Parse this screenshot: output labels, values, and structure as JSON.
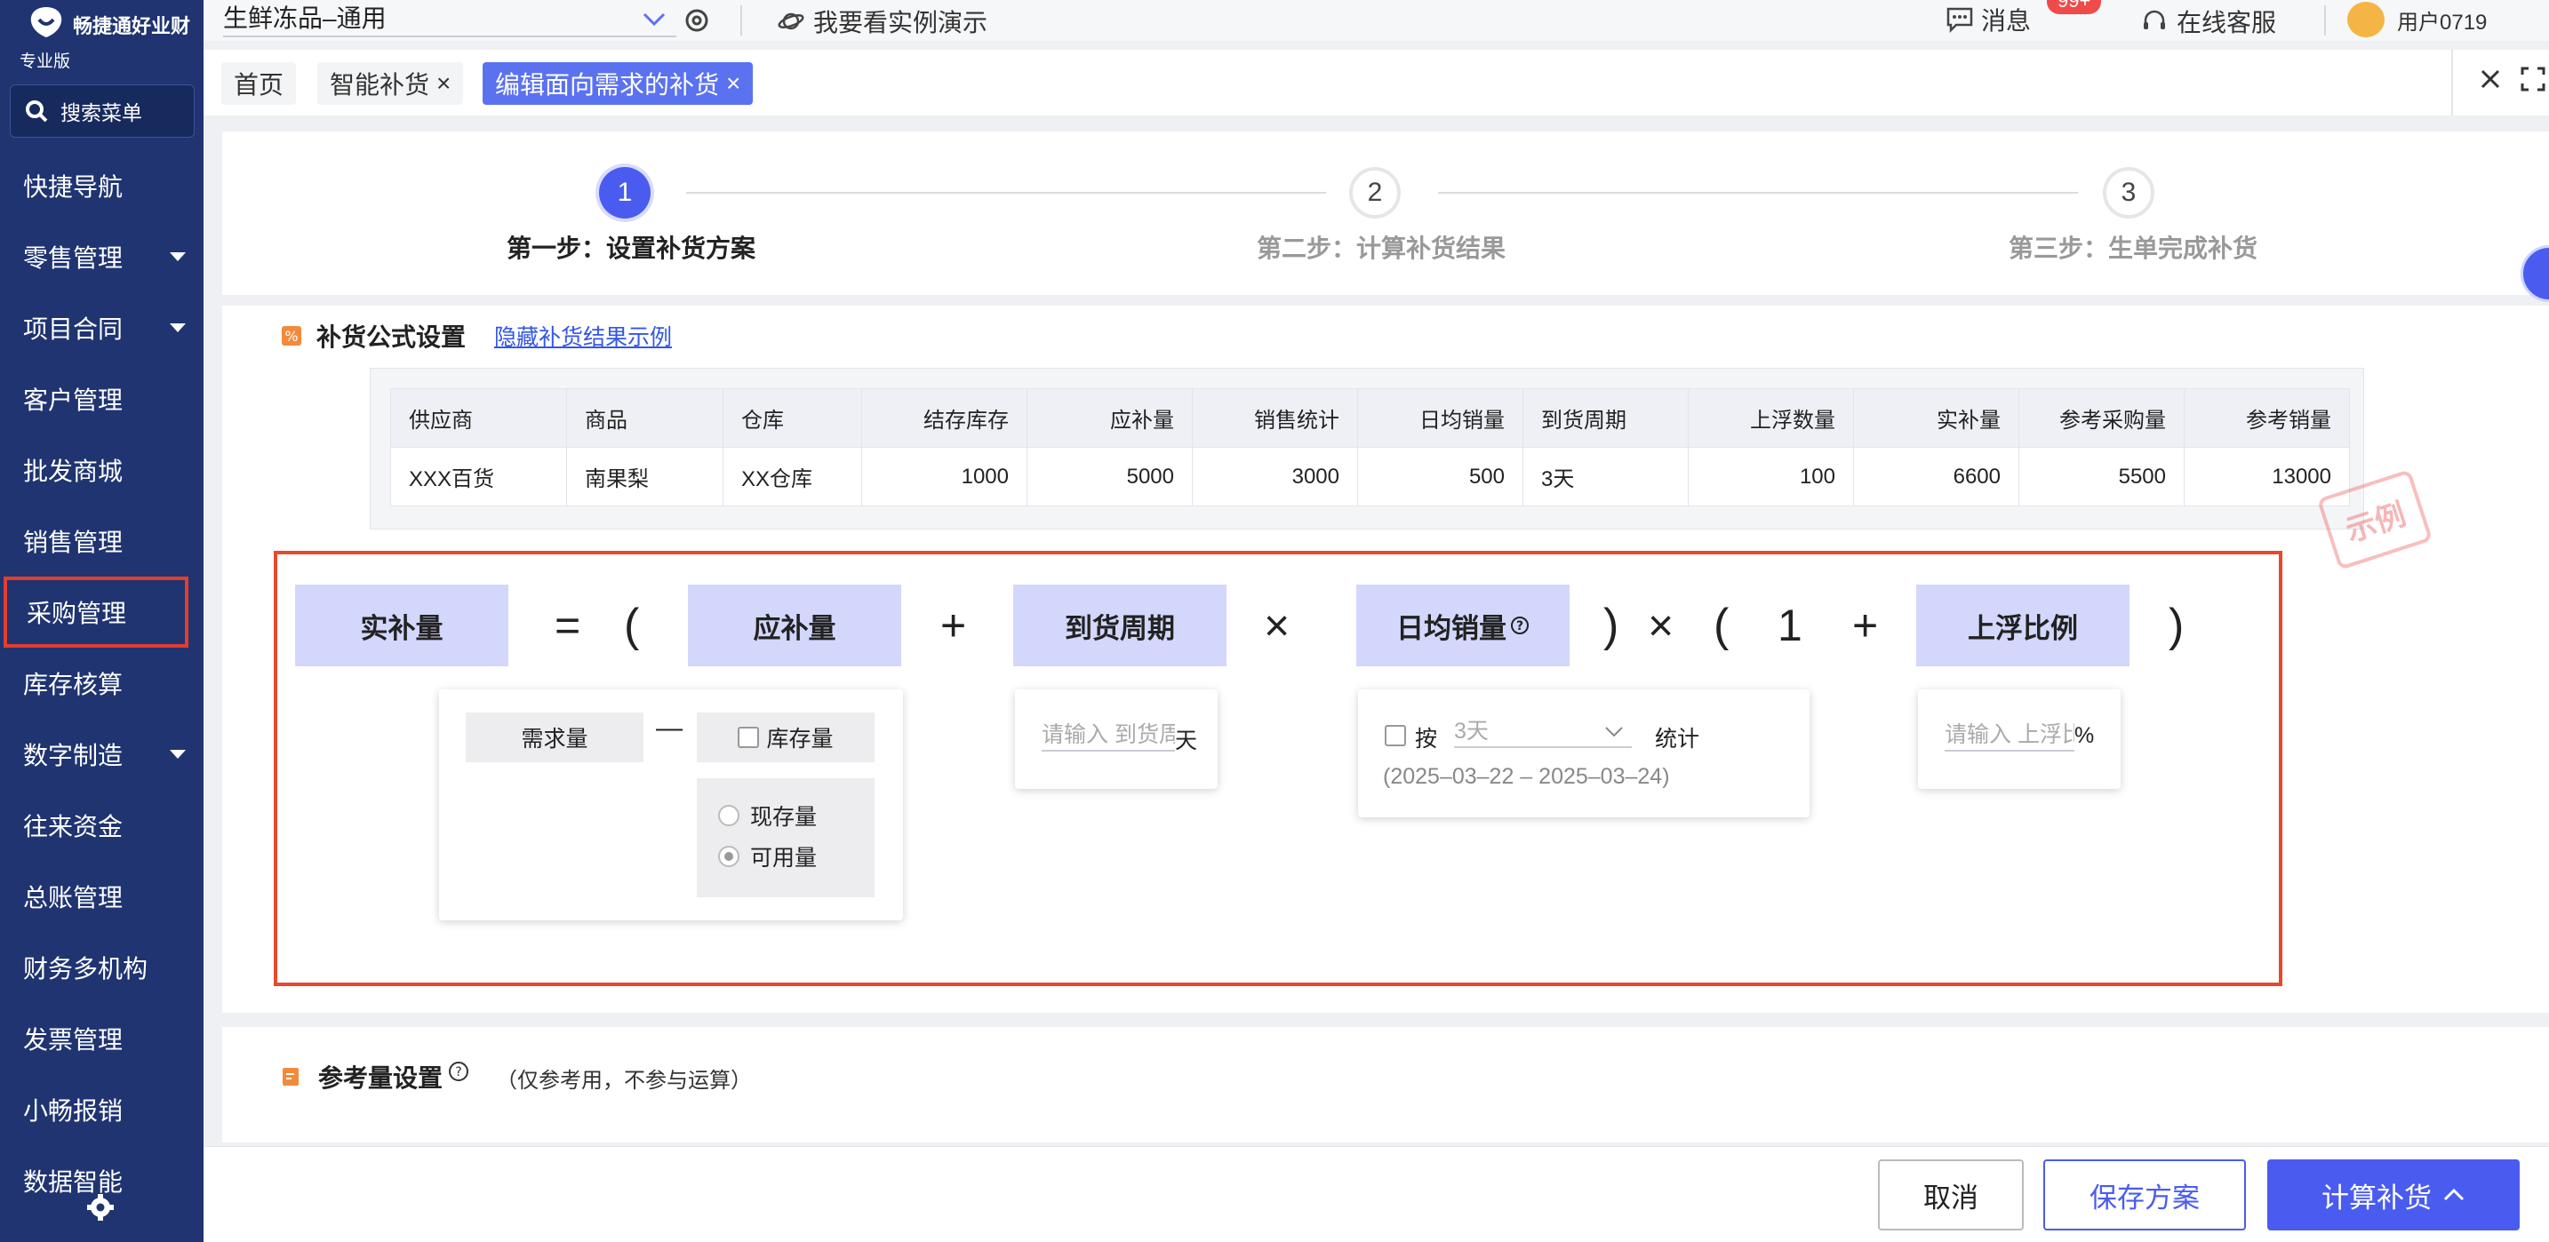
{
  "app": {
    "brand": "畅捷通好业财",
    "edition": "专业版",
    "search_menu": "搜索菜单"
  },
  "sidebar": {
    "items": [
      {
        "label": "快捷导航",
        "has_caret": false
      },
      {
        "label": "零售管理",
        "has_caret": true
      },
      {
        "label": "项目合同",
        "has_caret": true
      },
      {
        "label": "客户管理",
        "has_caret": false
      },
      {
        "label": "批发商城",
        "has_caret": false
      },
      {
        "label": "销售管理",
        "has_caret": false
      },
      {
        "label": "采购管理",
        "has_caret": false
      },
      {
        "label": "库存核算",
        "has_caret": false
      },
      {
        "label": "数字制造",
        "has_caret": true
      },
      {
        "label": "往来资金",
        "has_caret": false
      },
      {
        "label": "总账管理",
        "has_caret": false
      },
      {
        "label": "财务多机构",
        "has_caret": false
      },
      {
        "label": "发票管理",
        "has_caret": false
      },
      {
        "label": "小畅报销",
        "has_caret": false
      },
      {
        "label": "数据智能",
        "has_caret": false
      }
    ],
    "active_index": 6
  },
  "topbar": {
    "store": "生鲜冻品–通用",
    "demo": "我要看实例演示",
    "messages": "消息",
    "message_badge": "99+",
    "service": "在线客服",
    "user": "用户0719"
  },
  "tabs": [
    {
      "label": "首页",
      "closable": false,
      "active": false
    },
    {
      "label": "智能补货",
      "closable": true,
      "active": false
    },
    {
      "label": "编辑面向需求的补货",
      "closable": true,
      "active": true
    }
  ],
  "steps": [
    {
      "number": "1",
      "label": "第一步：设置补货方案",
      "active": true
    },
    {
      "number": "2",
      "label": "第二步：计算补货结果",
      "active": false
    },
    {
      "number": "3",
      "label": "第三步：生单完成补货",
      "active": false
    }
  ],
  "formula_section": {
    "title": "补货公式设置",
    "toggle_link": "隐藏补货结果示例",
    "stamp": "示例",
    "example_table": {
      "headers": [
        "供应商",
        "商品",
        "仓库",
        "结存库存",
        "应补量",
        "销售统计",
        "日均销量",
        "到货周期",
        "上浮数量",
        "实补量",
        "参考采购量",
        "参考销量"
      ],
      "row": [
        "XXX百货",
        "南果梨",
        "XX仓库",
        "1000",
        "5000",
        "3000",
        "500",
        "3天",
        "100",
        "6600",
        "5500",
        "13000"
      ]
    },
    "formula": {
      "result": "实补量",
      "equals": "=",
      "lparen": "(",
      "rparen": ")",
      "plus": "+",
      "times": "×",
      "one": "1",
      "term_replenish": "应补量",
      "term_lead": "到货周期",
      "term_daily": "日均销量",
      "term_float": "上浮比例",
      "demand_btn": "需求量",
      "minus": "—",
      "stock_btn": "库存量",
      "radio_current": "现存量",
      "radio_available": "可用量",
      "radio_selected": "可用量",
      "lead_placeholder": "请输入 到货周期",
      "lead_unit": "天",
      "by_label": "按",
      "period_value": "3天",
      "stat_label": "统计",
      "date_range": "(2025–03–22 – 2025–03–24)",
      "float_placeholder": "请输入 上浮比例",
      "float_unit": "%"
    }
  },
  "reference_section": {
    "title": "参考量设置",
    "note": "（仅参考用，不参与运算）"
  },
  "footer": {
    "cancel": "取消",
    "save": "保存方案",
    "calculate": "计算补货"
  },
  "colors": {
    "sidebar_bg": "#1f3470",
    "accent": "#4a5cf0",
    "highlight_border": "#e64a2e",
    "chip_bg": "#d3d7fb"
  }
}
